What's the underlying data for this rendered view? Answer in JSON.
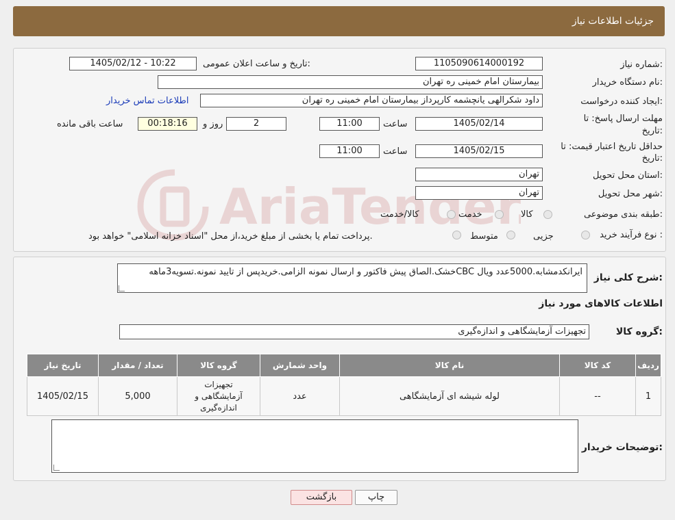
{
  "header": {
    "title": "جزئیات اطلاعات نیاز"
  },
  "form": {
    "need_number_label": "شماره نیاز:",
    "need_number": "1105090614000192",
    "announce_label": "تاریخ و ساعت اعلان عمومی:",
    "announce_value": "1405/02/12 - 10:22",
    "buyer_org_label": "نام دستگاه خریدار:",
    "buyer_org": "بیمارستان امام خمینی ره  تهران",
    "creator_label": "ایجاد کننده درخواست:",
    "creator": "داود شکرالهی یانچشمه کارپرداز بیمارستان امام خمینی ره  تهران",
    "contact_link": "اطلاعات تماس خریدار",
    "reply_deadline_label_1": "مهلت ارسال پاسخ: تا",
    "reply_deadline_label_2": "تاریخ:",
    "reply_date": "1405/02/14",
    "time_label": "ساعت",
    "reply_time": "11:00",
    "days_value": "2",
    "days_label": "روز و",
    "remaining_time": "00:18:16",
    "remaining_label": "ساعت باقی مانده",
    "price_validity_label_1": "حداقل تاریخ اعتبار قیمت: تا",
    "price_validity_label_2": "تاریخ:",
    "price_date": "1405/02/15",
    "price_time": "11:00",
    "province_label": "استان محل تحویل:",
    "province": "تهران",
    "city_label": "شهر محل تحویل:",
    "city": "تهران",
    "category_label": "طبقه بندی موضوعی:",
    "category_options": [
      "کالا",
      "خدمت",
      "کالا/خدمت"
    ],
    "process_label": "نوع فرآیند خرید :",
    "process_options": [
      "جزیی",
      "متوسط"
    ],
    "process_note": "پرداخت تمام یا بخشی از مبلغ خرید،از محل \"اسناد خزانه اسلامی\" خواهد بود."
  },
  "description": {
    "label": "شرح کلی نیاز:",
    "text": "ایرانکدمشابه.5000عدد ویال CBCخشک.الصاق پیش فاکتور و ارسال نمونه الزامی.خریدپس از تایید نمونه.تسویه3ماهه"
  },
  "goods": {
    "section_title": "اطلاعات کالاهای مورد نیاز",
    "group_label": "گروه کالا:",
    "group_value": "تجهیزات آزمایشگاهی و اندازه‌گیری",
    "table": {
      "headers": [
        "ردیف",
        "کد کالا",
        "نام کالا",
        "واحد شمارش",
        "گروه کالا",
        "تعداد / مقدار",
        "تاریخ نیاز"
      ],
      "rows": [
        [
          "1",
          "--",
          "لوله شیشه ای آزمایشگاهی",
          "عدد",
          "تجهیزات آزمایشگاهی و اندازه‌گیری",
          "5,000",
          "1405/02/15"
        ]
      ]
    }
  },
  "buyer_notes": {
    "label": "توضیحات خریدار:",
    "value": ""
  },
  "buttons": {
    "print": "چاپ",
    "back": "بازگشت"
  },
  "watermark": {
    "text": "AriaTender.neT"
  }
}
